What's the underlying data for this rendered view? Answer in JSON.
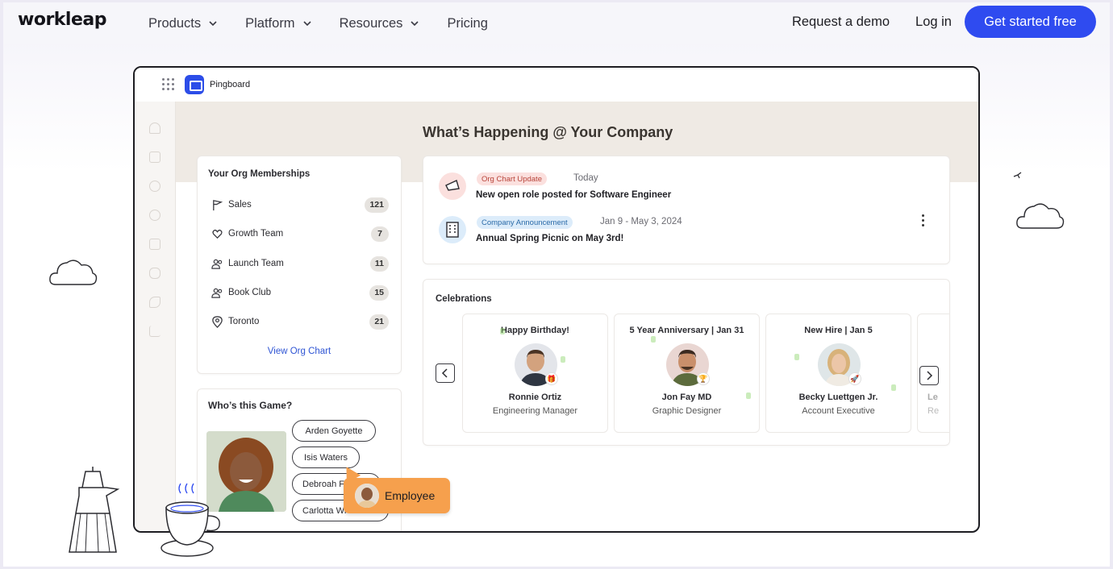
{
  "nav": {
    "logo": "workleap",
    "links": [
      {
        "label": "Products",
        "has_dropdown": true
      },
      {
        "label": "Platform",
        "has_dropdown": true
      },
      {
        "label": "Resources",
        "has_dropdown": true
      },
      {
        "label": "Pricing",
        "has_dropdown": false
      }
    ],
    "request_demo": "Request a demo",
    "login": "Log in",
    "cta": "Get started free",
    "cta_color": "#2f4bf0"
  },
  "app": {
    "name": "Pingboard",
    "headline": "What’s Happening @ Your Company",
    "memberships": {
      "title": "Your Org Memberships",
      "items": [
        {
          "label": "Sales",
          "count": "121",
          "icon": "flag-icon"
        },
        {
          "label": "Growth Team",
          "count": "7",
          "icon": "hearts-icon"
        },
        {
          "label": "Launch Team",
          "count": "11",
          "icon": "users-icon"
        },
        {
          "label": "Book Club",
          "count": "15",
          "icon": "users-icon"
        },
        {
          "label": "Toronto",
          "count": "21",
          "icon": "location-pin-icon"
        }
      ],
      "link": "View Org Chart"
    },
    "game": {
      "title": "Who’s this Game?",
      "options": [
        "Arden Goyette",
        "Isis Waters",
        "Debroah F",
        "Carlotta Wi"
      ]
    },
    "tooltip": {
      "label": "Employee"
    },
    "announcements": [
      {
        "tag": "Org Chart Update",
        "date": "Today",
        "text": "New open role posted for Software Engineer",
        "icon": "megaphone-icon",
        "tag_bg": "#fbe0de",
        "tag_color": "#b8443a"
      },
      {
        "tag": "Company Announcement",
        "date": "Jan 9 - May 3, 2024",
        "text": "Annual Spring Picnic on May 3rd!",
        "icon": "building-icon",
        "tag_bg": "#dcecfa",
        "tag_color": "#2a6aa8"
      }
    ],
    "celebrations": {
      "title": "Celebrations",
      "cards": [
        {
          "title": "Happy Birthday!",
          "name": "Ronnie Ortiz",
          "role": "Engineering Manager",
          "badge": "gift-icon"
        },
        {
          "title": "5 Year Anniversary | Jan 31",
          "name": "Jon Fay MD",
          "role": "Graphic Designer",
          "badge": "trophy-icon"
        },
        {
          "title": "New Hire | Jan 5",
          "name": "Becky Luettgen Jr.",
          "role": "Account Executive",
          "badge": "rocket-icon"
        },
        {
          "title": "",
          "name": "Le",
          "role": "Re",
          "badge": ""
        }
      ]
    }
  }
}
